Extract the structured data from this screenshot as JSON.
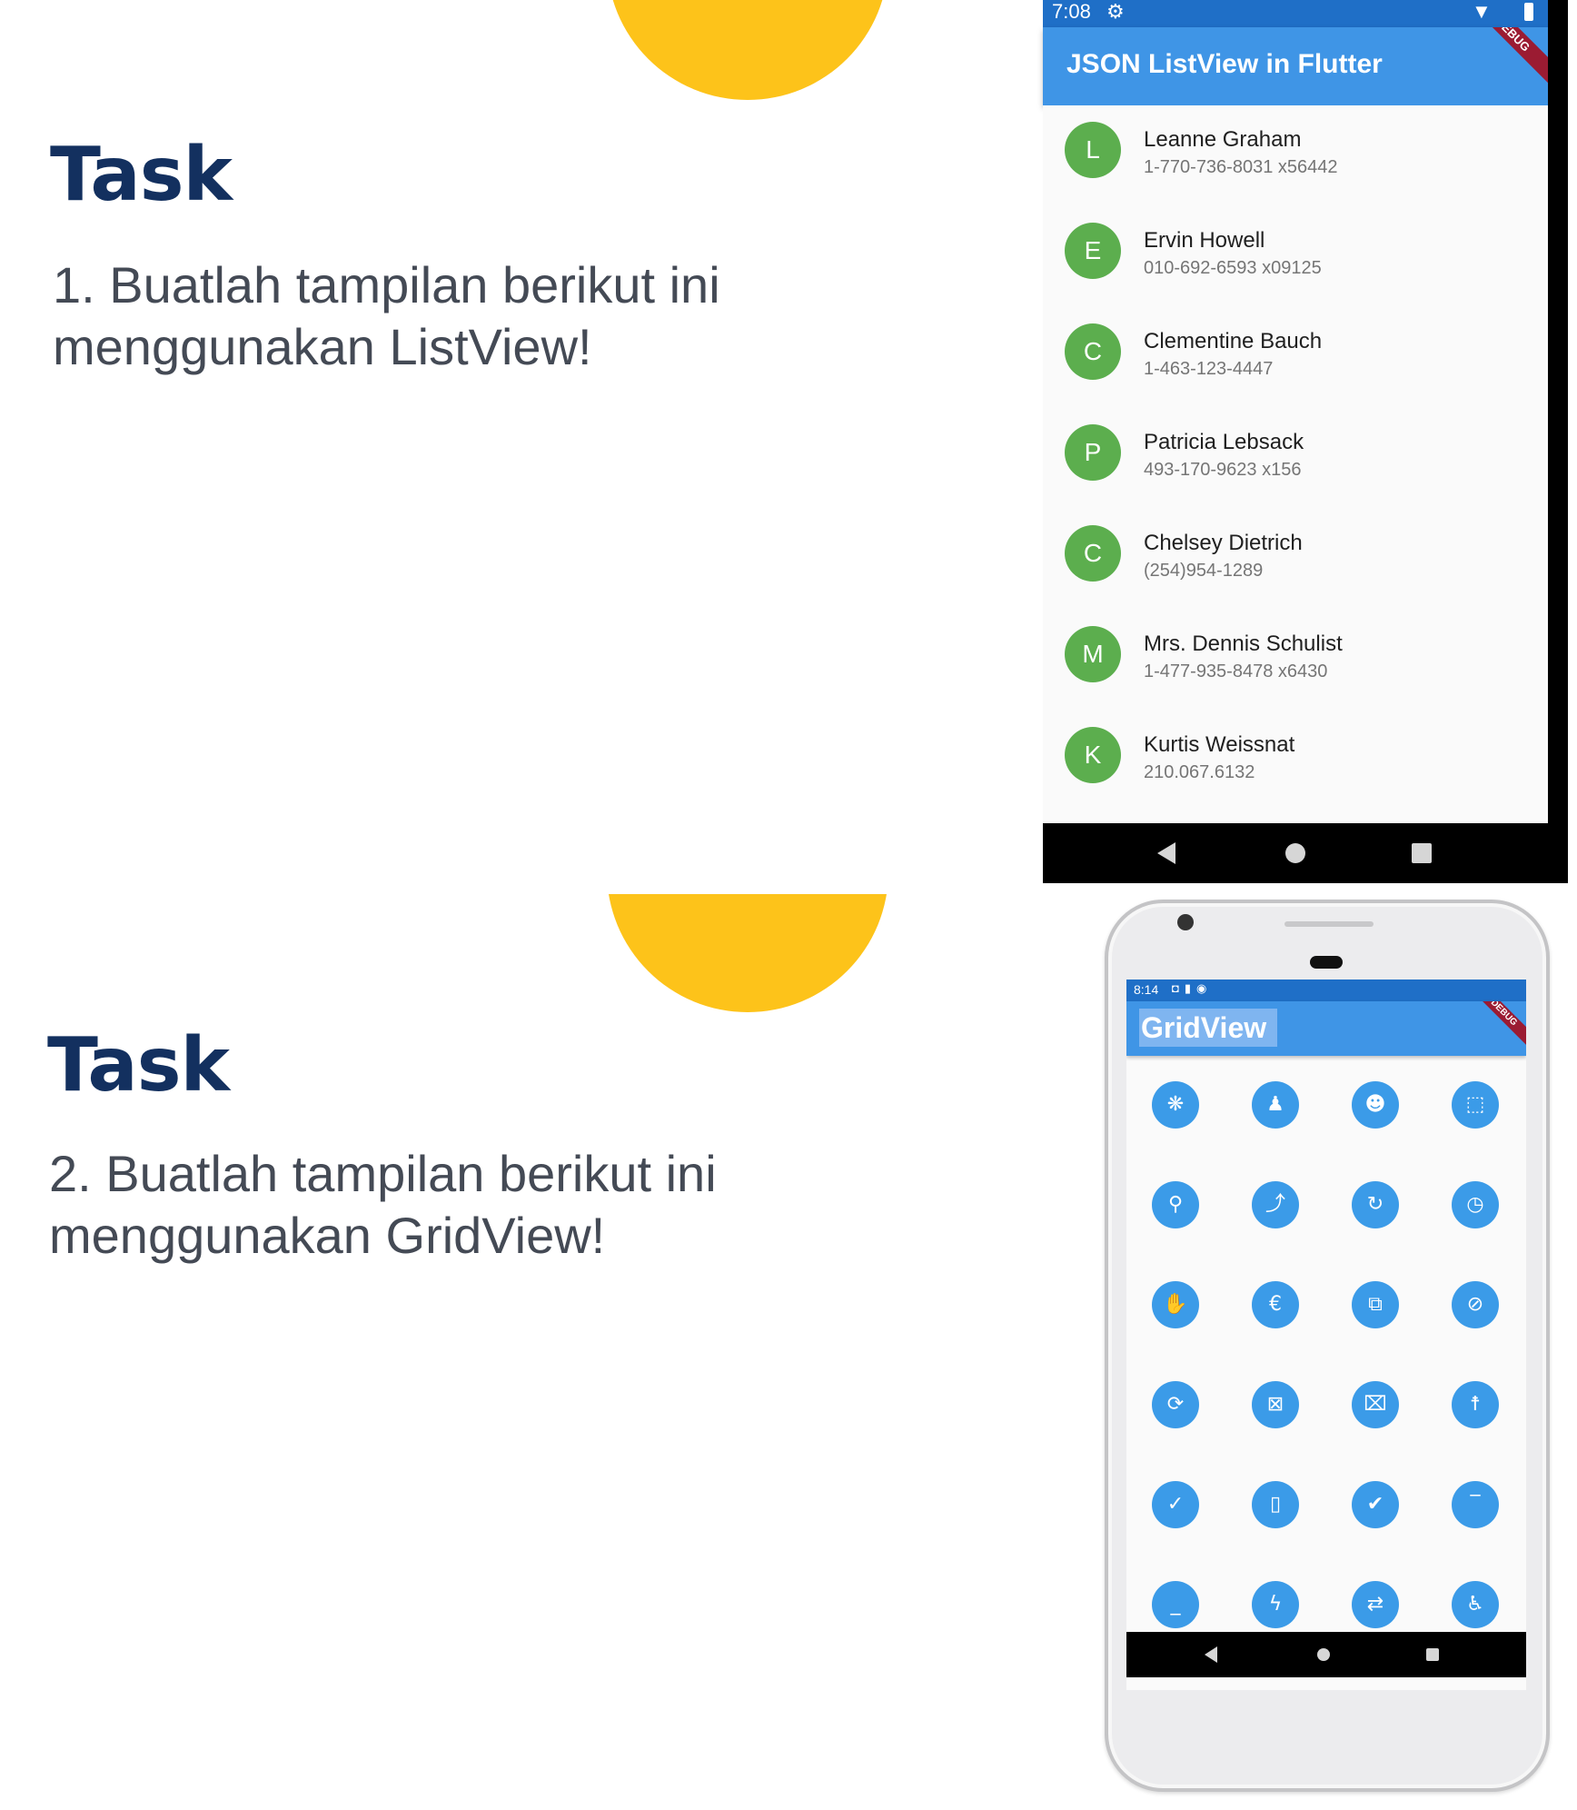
{
  "colors": {
    "title": "#13305f",
    "body_text": "#444a55",
    "sun": "#fdc31a",
    "appbar": "#3f95e6",
    "statusbar": "#1f6fc7",
    "avatar": "#5cae4e",
    "grid_icon_bg": "#3b9be8"
  },
  "slide1": {
    "title": "Task",
    "description": "1. Buatlah tampilan berikut ini menggunakan ListView!",
    "phone": {
      "status_time": "7:08",
      "debug_label": "DEBUG",
      "app_title": "JSON ListView in Flutter",
      "items": [
        {
          "initial": "L",
          "name": "Leanne Graham",
          "phone": "1-770-736-8031 x56442"
        },
        {
          "initial": "E",
          "name": "Ervin Howell",
          "phone": "010-692-6593 x09125"
        },
        {
          "initial": "C",
          "name": "Clementine Bauch",
          "phone": "1-463-123-4447"
        },
        {
          "initial": "P",
          "name": "Patricia Lebsack",
          "phone": "493-170-9623 x156"
        },
        {
          "initial": "C",
          "name": "Chelsey Dietrich",
          "phone": "(254)954-1289"
        },
        {
          "initial": "M",
          "name": "Mrs. Dennis Schulist",
          "phone": "1-477-935-8478 x6430"
        },
        {
          "initial": "K",
          "name": "Kurtis Weissnat",
          "phone": "210.067.6132"
        }
      ]
    }
  },
  "slide2": {
    "title": "Task",
    "description": "2. Buatlah tampilan berikut ini menggunakan GridView!",
    "phone": {
      "status_time": "8:14",
      "debug_label": "DEBUG",
      "app_title": "GridView",
      "grid_icons": [
        {
          "name": "pets-icon",
          "glyph": "❋"
        },
        {
          "name": "person-icon",
          "glyph": "♟"
        },
        {
          "name": "record-voice-icon",
          "glyph": "☻"
        },
        {
          "name": "crop-free-icon",
          "glyph": "⬚"
        },
        {
          "name": "directions-run-icon",
          "glyph": "⚲"
        },
        {
          "name": "trending-up-icon",
          "glyph": "⤴"
        },
        {
          "name": "restore-icon",
          "glyph": "↻"
        },
        {
          "name": "schedule-icon",
          "glyph": "◷"
        },
        {
          "name": "pan-tool-icon",
          "glyph": "✋"
        },
        {
          "name": "euro-icon",
          "glyph": "€"
        },
        {
          "name": "g-translate-icon",
          "glyph": "⧉"
        },
        {
          "name": "remove-shopping-cart-icon",
          "glyph": "⊘"
        },
        {
          "name": "find-replace-icon",
          "glyph": "⟳"
        },
        {
          "name": "speaker-notes-off-icon",
          "glyph": "⊠"
        },
        {
          "name": "delete-forever-icon",
          "glyph": "⌧"
        },
        {
          "name": "accessibility-icon",
          "glyph": "☨"
        },
        {
          "name": "check-circle-outline-icon",
          "glyph": "✓"
        },
        {
          "name": "delete-outline-icon",
          "glyph": "▯"
        },
        {
          "name": "done-all-icon",
          "glyph": "✔"
        },
        {
          "name": "minimize-top-icon",
          "glyph": "‾"
        },
        {
          "name": "minimize-icon",
          "glyph": "_"
        },
        {
          "name": "offline-bolt-icon",
          "glyph": "ϟ"
        },
        {
          "name": "swap-horizontal-circle-icon",
          "glyph": "⇄"
        },
        {
          "name": "accessible-icon",
          "glyph": "♿"
        }
      ]
    }
  }
}
